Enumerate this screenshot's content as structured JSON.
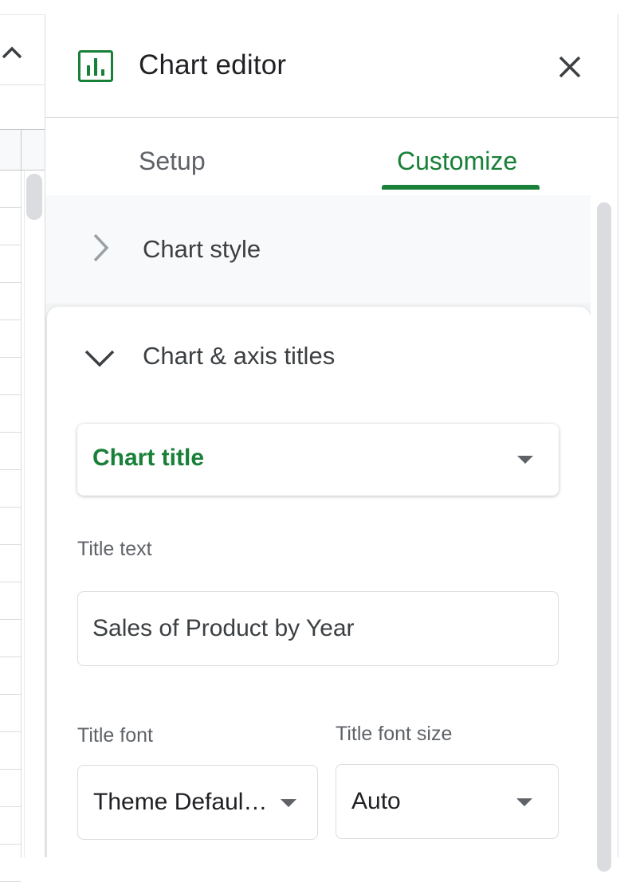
{
  "panel": {
    "title": "Chart editor"
  },
  "tabs": [
    {
      "label": "Setup",
      "active": false
    },
    {
      "label": "Customize",
      "active": true
    }
  ],
  "sections": {
    "chart_style": "Chart style",
    "chart_axis_titles": "Chart & axis titles"
  },
  "title_type_dropdown": {
    "selected": "Chart title"
  },
  "title_text": {
    "label": "Title text",
    "value": "Sales of Product by Year"
  },
  "title_font": {
    "label": "Title font",
    "selected": "Theme Defaul…"
  },
  "title_font_size": {
    "label": "Title font size",
    "selected": "Auto"
  },
  "colors": {
    "accent": "#188038",
    "text": "#3c4043",
    "muted": "#5f6368",
    "border": "#dadce0"
  },
  "icons": [
    "chevron-up-icon",
    "chart-icon",
    "close-icon",
    "chevron-right-icon",
    "chevron-down-icon",
    "dropdown-caret-icon"
  ]
}
